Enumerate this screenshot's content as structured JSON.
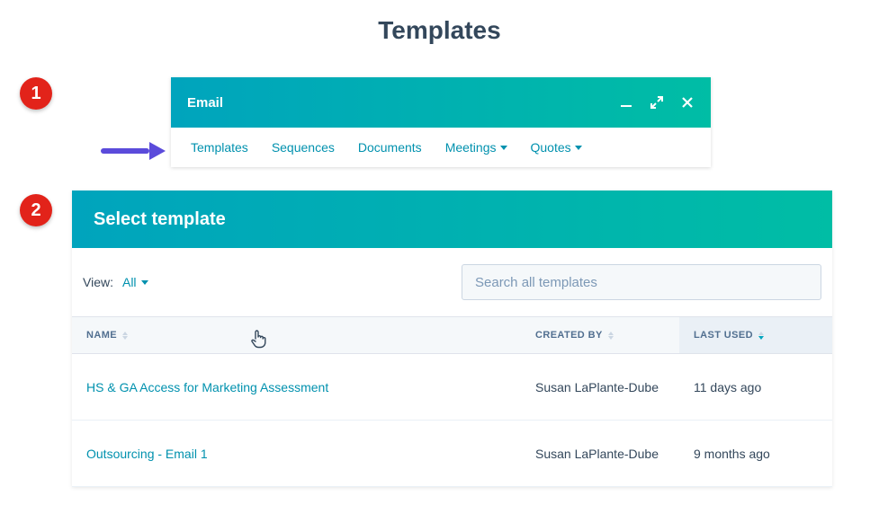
{
  "page": {
    "title": "Templates"
  },
  "annotations": {
    "badge1": "1",
    "badge2": "2"
  },
  "emailPanel": {
    "title": "Email",
    "tabs": {
      "templates": "Templates",
      "sequences": "Sequences",
      "documents": "Documents",
      "meetings": "Meetings",
      "quotes": "Quotes"
    }
  },
  "selectPanel": {
    "title": "Select template",
    "viewLabel": "View:",
    "viewValue": "All",
    "searchPlaceholder": "Search all templates",
    "columns": {
      "name": "NAME",
      "createdBy": "CREATED BY",
      "lastUsed": "LAST USED"
    },
    "rows": [
      {
        "name": "HS & GA Access for Marketing Assessment",
        "createdBy": "Susan LaPlante-Dube",
        "lastUsed": "11 days ago"
      },
      {
        "name": "Outsourcing - Email 1",
        "createdBy": "Susan LaPlante-Dube",
        "lastUsed": "9 months ago"
      }
    ]
  }
}
